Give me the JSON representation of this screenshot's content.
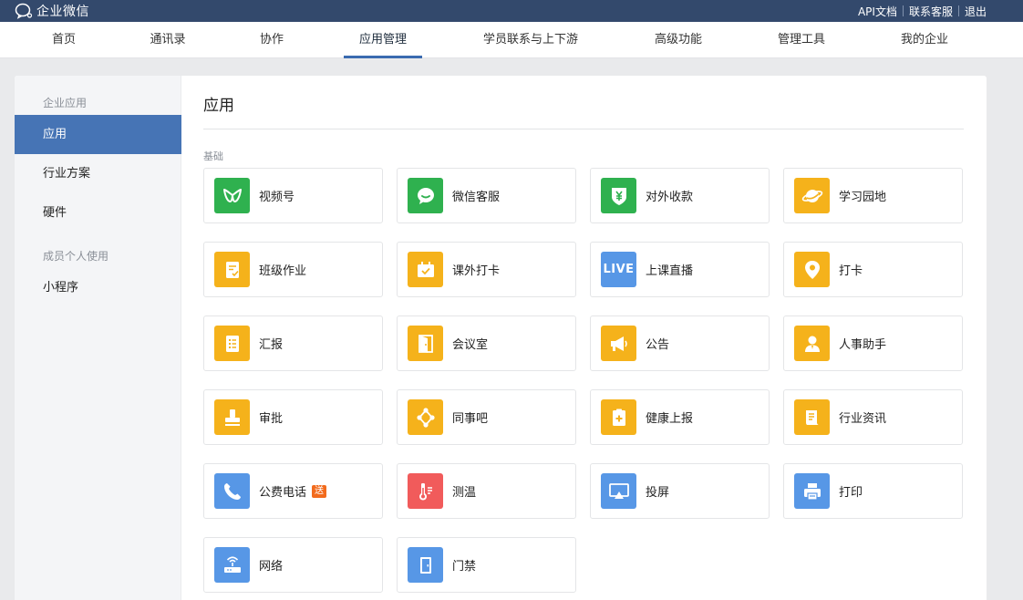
{
  "app": {
    "name": "企业微信"
  },
  "toplinks": {
    "api": "API文档",
    "support": "联系客服",
    "logout": "退出"
  },
  "nav": [
    {
      "label": "首页"
    },
    {
      "label": "通讯录"
    },
    {
      "label": "协作"
    },
    {
      "label": "应用管理",
      "active": true
    },
    {
      "label": "学员联系与上下游"
    },
    {
      "label": "高级功能"
    },
    {
      "label": "管理工具"
    },
    {
      "label": "我的企业"
    }
  ],
  "sidebar": {
    "group1": "企业应用",
    "items1": [
      {
        "label": "应用",
        "active": true
      },
      {
        "label": "行业方案"
      },
      {
        "label": "硬件"
      }
    ],
    "group2": "成员个人使用",
    "items2": [
      {
        "label": "小程序"
      }
    ]
  },
  "content": {
    "title": "应用",
    "section": "基础"
  },
  "colors": {
    "green": "#2fb14f",
    "yellow": "#f5b21b",
    "blue": "#5797e6",
    "red": "#f15b5b",
    "nav_active": "#3a6bb0",
    "sidebar_active": "#4674b5"
  },
  "apps": [
    {
      "label": "视频号",
      "icon": "channels-icon",
      "color": "#2fb14f"
    },
    {
      "label": "微信客服",
      "icon": "wechat-service-icon",
      "color": "#2fb14f"
    },
    {
      "label": "对外收款",
      "icon": "payment-icon",
      "color": "#2fb14f"
    },
    {
      "label": "学习园地",
      "icon": "planet-icon",
      "color": "#f5b21b"
    },
    {
      "label": "班级作业",
      "icon": "homework-icon",
      "color": "#f5b21b"
    },
    {
      "label": "课外打卡",
      "icon": "extracurricular-checkin-icon",
      "color": "#f5b21b"
    },
    {
      "label": "上课直播",
      "icon": "live-icon",
      "color": "#5797e6",
      "text": "LIVE"
    },
    {
      "label": "打卡",
      "icon": "location-pin-icon",
      "color": "#f5b21b"
    },
    {
      "label": "汇报",
      "icon": "report-icon",
      "color": "#f5b21b"
    },
    {
      "label": "会议室",
      "icon": "meeting-room-icon",
      "color": "#f5b21b"
    },
    {
      "label": "公告",
      "icon": "megaphone-icon",
      "color": "#f5b21b"
    },
    {
      "label": "人事助手",
      "icon": "hr-assistant-icon",
      "color": "#f5b21b"
    },
    {
      "label": "审批",
      "icon": "stamp-icon",
      "color": "#f5b21b"
    },
    {
      "label": "同事吧",
      "icon": "colleague-network-icon",
      "color": "#f5b21b"
    },
    {
      "label": "健康上报",
      "icon": "health-report-icon",
      "color": "#f5b21b"
    },
    {
      "label": "行业资讯",
      "icon": "news-icon",
      "color": "#f5b21b"
    },
    {
      "label": "公费电话",
      "icon": "phone-icon",
      "color": "#5797e6",
      "badge": "送"
    },
    {
      "label": "测温",
      "icon": "thermometer-icon",
      "color": "#f15b5b"
    },
    {
      "label": "投屏",
      "icon": "screen-cast-icon",
      "color": "#5797e6"
    },
    {
      "label": "打印",
      "icon": "printer-icon",
      "color": "#5797e6"
    },
    {
      "label": "网络",
      "icon": "network-icon",
      "color": "#5797e6"
    },
    {
      "label": "门禁",
      "icon": "access-door-icon",
      "color": "#5797e6"
    }
  ]
}
